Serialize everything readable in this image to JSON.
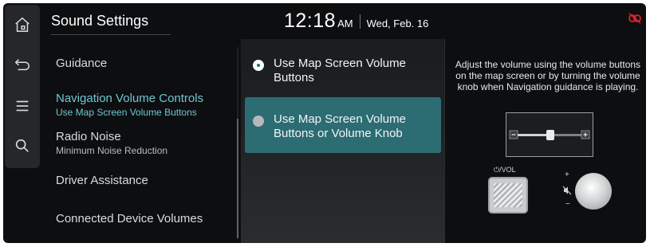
{
  "header": {
    "title": "Sound Settings",
    "time": "12:18",
    "ampm": "AM",
    "date": "Wed, Feb. 16"
  },
  "rail": {
    "items": [
      {
        "icon": "home-icon"
      },
      {
        "icon": "back-icon"
      },
      {
        "icon": "menu-icon"
      },
      {
        "icon": "search-icon"
      }
    ]
  },
  "menu": {
    "items": [
      {
        "label": "Guidance",
        "sub": ""
      },
      {
        "label": "Navigation Volume Controls",
        "sub": "Use Map Screen Volume Buttons"
      },
      {
        "label": "Radio Noise",
        "sub": "Minimum Noise Reduction"
      },
      {
        "label": "Driver Assistance",
        "sub": ""
      },
      {
        "label": "Connected Device Volumes",
        "sub": ""
      }
    ]
  },
  "options": {
    "items": [
      {
        "line1": "Use Map Screen Volume",
        "line2": "Buttons"
      },
      {
        "line1": "Use Map Screen Volume",
        "line2": "Buttons or Volume Knob"
      }
    ]
  },
  "description": {
    "text": "Adjust the volume using the volume buttons on the map screen or by turning the volume knob when Navigation guidance is playing.",
    "knob_label": "⏻/VOL",
    "plus": "+",
    "minus": "−"
  },
  "colors": {
    "accent": "#6fc7cf",
    "selected_option": "#2c6c73",
    "background": "#0d0e10"
  }
}
